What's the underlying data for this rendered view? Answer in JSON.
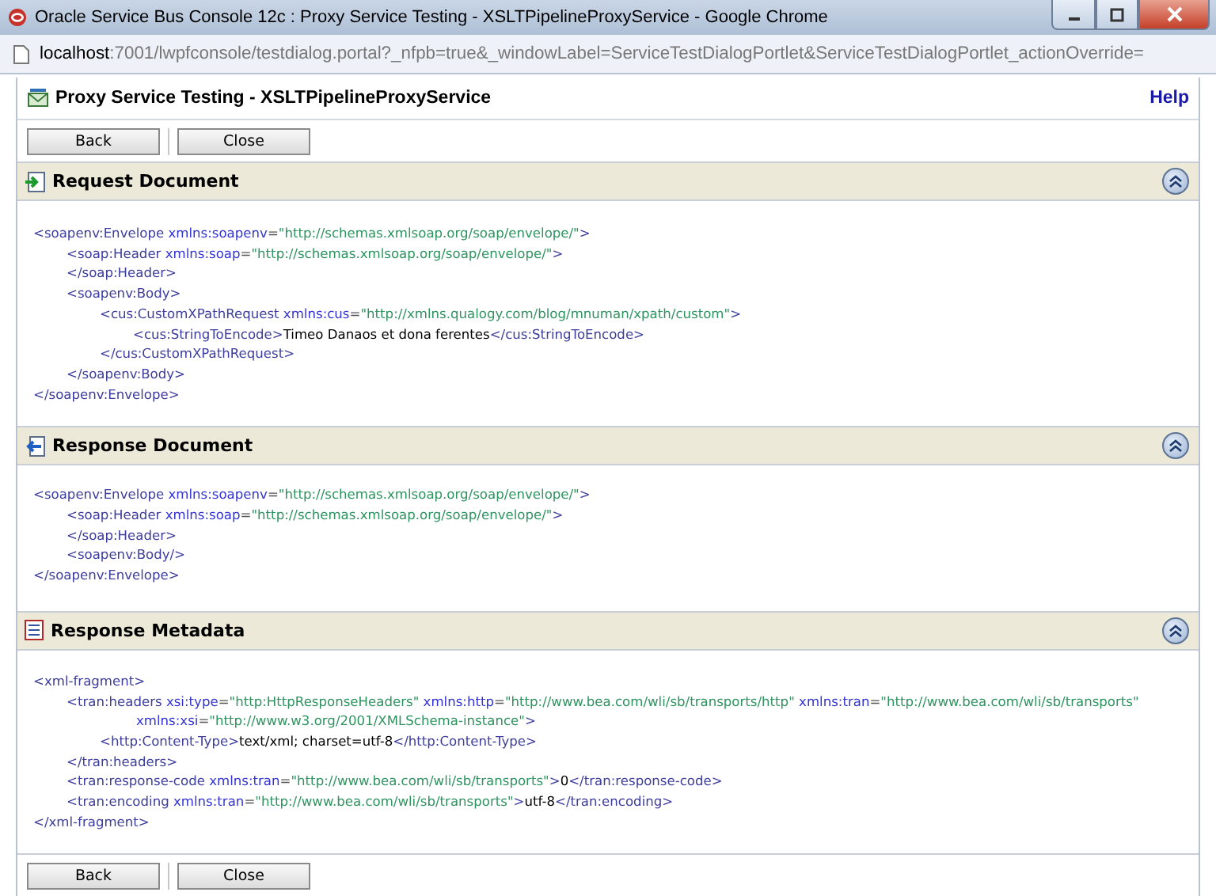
{
  "window": {
    "title": "Oracle Service Bus Console 12c : Proxy Service Testing - XSLTPipelineProxyService - Google Chrome"
  },
  "address_bar": {
    "host": "localhost",
    "rest": ":7001/lwpfconsole/testdialog.portal?_nfpb=true&_windowLabel=ServiceTestDialogPortlet&ServiceTestDialogPortlet_actionOverride="
  },
  "page": {
    "title": "Proxy Service Testing - XSLTPipelineProxyService",
    "help": "Help"
  },
  "top_buttons": [
    "Back",
    "Close"
  ],
  "sections": [
    {
      "kind": "request",
      "title": "Request Document",
      "expanded": true,
      "lines": [
        {
          "tokens": [
            {
              "kind": "tag",
              "text": "<soapenv:Envelope"
            },
            {
              "kind": "attr",
              "text": " xmlns:soapenv"
            },
            {
              "kind": "punct",
              "text": "="
            },
            {
              "kind": "value",
              "text": "\"http://schemas.xmlsoap.org/soap/envelope/\""
            },
            {
              "kind": "tag",
              "text": ">"
            }
          ],
          "children": [
            {
              "tokens": [
                {
                  "kind": "tag",
                  "text": "<soap:Header"
                },
                {
                  "kind": "attr",
                  "text": " xmlns:soap"
                },
                {
                  "kind": "punct",
                  "text": "="
                },
                {
                  "kind": "value",
                  "text": "\"http://schemas.xmlsoap.org/soap/envelope/\""
                },
                {
                  "kind": "tag",
                  "text": ">"
                }
              ]
            },
            {
              "tokens": [
                {
                  "kind": "tag",
                  "text": "</soap:Header>"
                }
              ]
            },
            {
              "tokens": [
                {
                  "kind": "tag",
                  "text": "<soapenv:Body>"
                }
              ],
              "children": [
                {
                  "tokens": [
                    {
                      "kind": "tag",
                      "text": "<cus:CustomXPathRequest"
                    },
                    {
                      "kind": "attr",
                      "text": " xmlns:cus"
                    },
                    {
                      "kind": "punct",
                      "text": "="
                    },
                    {
                      "kind": "value",
                      "text": "\"http://xmlns.qualogy.com/blog/mnuman/xpath/custom\""
                    },
                    {
                      "kind": "tag",
                      "text": ">"
                    }
                  ],
                  "children": [
                    {
                      "tokens": [
                        {
                          "kind": "tag",
                          "text": "<cus:StringToEncode>"
                        },
                        {
                          "kind": "text",
                          "text": "Timeo Danaos et dona ferentes"
                        },
                        {
                          "kind": "tag",
                          "text": "</cus:StringToEncode>"
                        }
                      ]
                    }
                  ]
                },
                {
                  "tokens": [
                    {
                      "kind": "tag",
                      "text": "</cus:CustomXPathRequest>"
                    }
                  ]
                }
              ]
            },
            {
              "tokens": [
                {
                  "kind": "tag",
                  "text": "</soapenv:Body>"
                }
              ]
            }
          ]
        },
        {
          "tokens": [
            {
              "kind": "tag",
              "text": "</soapenv:Envelope>"
            }
          ]
        }
      ]
    },
    {
      "kind": "response",
      "title": "Response Document",
      "expanded": true,
      "lines": [
        {
          "tokens": [
            {
              "kind": "tag",
              "text": "<soapenv:Envelope"
            },
            {
              "kind": "attr",
              "text": " xmlns:soapenv"
            },
            {
              "kind": "punct",
              "text": "="
            },
            {
              "kind": "value",
              "text": "\"http://schemas.xmlsoap.org/soap/envelope/\""
            },
            {
              "kind": "tag",
              "text": ">"
            }
          ],
          "children": [
            {
              "tokens": [
                {
                  "kind": "tag",
                  "text": "<soap:Header"
                },
                {
                  "kind": "attr",
                  "text": " xmlns:soap"
                },
                {
                  "kind": "punct",
                  "text": "="
                },
                {
                  "kind": "value",
                  "text": "\"http://schemas.xmlsoap.org/soap/envelope/\""
                },
                {
                  "kind": "tag",
                  "text": ">"
                }
              ]
            },
            {
              "tokens": [
                {
                  "kind": "tag",
                  "text": "</soap:Header>"
                }
              ]
            },
            {
              "tokens": [
                {
                  "kind": "tag",
                  "text": "<soapenv:Body/>"
                }
              ]
            }
          ]
        },
        {
          "tokens": [
            {
              "kind": "tag",
              "text": "</soapenv:Envelope>"
            }
          ]
        }
      ]
    },
    {
      "kind": "metadata",
      "title": "Response Metadata",
      "expanded": true,
      "lines": [
        {
          "tokens": [
            {
              "kind": "tag",
              "text": "<xml-fragment>"
            }
          ],
          "children": [
            {
              "tokens": [
                {
                  "kind": "tag",
                  "text": "<tran:headers"
                },
                {
                  "kind": "attr",
                  "text": " xsi:type"
                },
                {
                  "kind": "punct",
                  "text": "="
                },
                {
                  "kind": "value",
                  "text": "\"http:HttpResponseHeaders\""
                },
                {
                  "kind": "attr",
                  "text": " xmlns:http"
                },
                {
                  "kind": "punct",
                  "text": "="
                },
                {
                  "kind": "value",
                  "text": "\"http://www.bea.com/wli/sb/transports/http\""
                },
                {
                  "kind": "attr",
                  "text": " xmlns:tran"
                },
                {
                  "kind": "punct",
                  "text": "="
                },
                {
                  "kind": "value",
                  "text": "\"http://www.bea.com/wli/sb/transports\""
                },
                {
                  "kind": "attr",
                  "text": " xmlns:xsi"
                },
                {
                  "kind": "punct",
                  "text": "="
                },
                {
                  "kind": "value",
                  "text": "\"http://www.w3.org/2001/XMLSchema-instance\""
                },
                {
                  "kind": "tag",
                  "text": ">"
                }
              ],
              "children": [
                {
                  "tokens": [
                    {
                      "kind": "tag",
                      "text": "<http:Content-Type>"
                    },
                    {
                      "kind": "text",
                      "text": "text/xml; charset=utf-8"
                    },
                    {
                      "kind": "tag",
                      "text": "</http:Content-Type>"
                    }
                  ]
                }
              ]
            },
            {
              "tokens": [
                {
                  "kind": "tag",
                  "text": "</tran:headers>"
                }
              ]
            },
            {
              "tokens": [
                {
                  "kind": "tag",
                  "text": "<tran:response-code"
                },
                {
                  "kind": "attr",
                  "text": " xmlns:tran"
                },
                {
                  "kind": "punct",
                  "text": "="
                },
                {
                  "kind": "value",
                  "text": "\"http://www.bea.com/wli/sb/transports\""
                },
                {
                  "kind": "tag",
                  "text": ">"
                },
                {
                  "kind": "text",
                  "text": "0"
                },
                {
                  "kind": "tag",
                  "text": "</tran:response-code>"
                }
              ]
            },
            {
              "tokens": [
                {
                  "kind": "tag",
                  "text": "<tran:encoding"
                },
                {
                  "kind": "attr",
                  "text": " xmlns:tran"
                },
                {
                  "kind": "punct",
                  "text": "="
                },
                {
                  "kind": "value",
                  "text": "\"http://www.bea.com/wli/sb/transports\""
                },
                {
                  "kind": "tag",
                  "text": ">"
                },
                {
                  "kind": "text",
                  "text": "utf-8"
                },
                {
                  "kind": "tag",
                  "text": "</tran:encoding>"
                }
              ]
            }
          ]
        },
        {
          "tokens": [
            {
              "kind": "tag",
              "text": "</xml-fragment>"
            }
          ]
        }
      ]
    }
  ],
  "bottom_buttons": [
    "Back",
    "Close"
  ]
}
